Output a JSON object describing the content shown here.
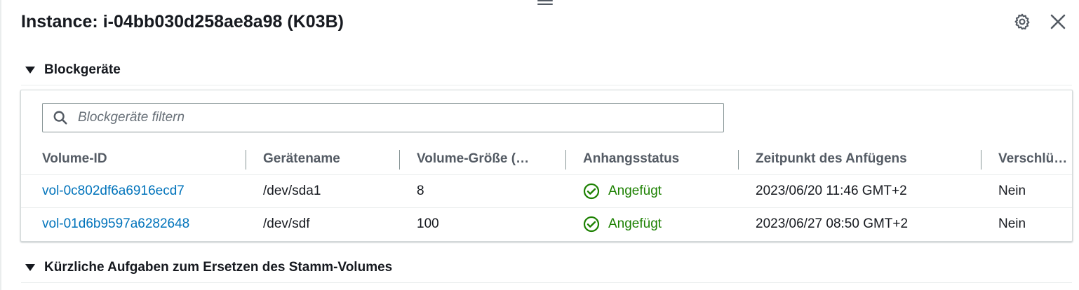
{
  "header": {
    "title": "Instance: i-04bb030d258ae8a98 (K03B)",
    "settings_icon": "gear-icon",
    "close_icon": "close-icon"
  },
  "block_devices": {
    "section_title": "Blockgeräte",
    "search": {
      "placeholder": "Blockgeräte filtern",
      "value": ""
    },
    "columns": [
      "Volume-ID",
      "Gerätename",
      "Volume-Größe (…",
      "Anhangsstatus",
      "Zeitpunkt des Anfügens",
      "Verschlüs…"
    ],
    "rows": [
      {
        "volume_id": "vol-0c802df6a6916ecd7",
        "device": "/dev/sda1",
        "size": "8",
        "status": "Angefügt",
        "attached_at": "2023/06/20 11:46 GMT+2",
        "encrypted": "Nein"
      },
      {
        "volume_id": "vol-01d6b9597a6282648",
        "device": "/dev/sdf",
        "size": "100",
        "status": "Angefügt",
        "attached_at": "2023/06/27 08:50 GMT+2",
        "encrypted": "Nein"
      }
    ]
  },
  "replace_root_tasks": {
    "section_title": "Kürzliche Aufgaben zum Ersetzen des Stamm-Volumes"
  },
  "colors": {
    "link": "#0073bb",
    "success": "#1d8102",
    "text": "#16191f",
    "header_text": "#545b64"
  }
}
